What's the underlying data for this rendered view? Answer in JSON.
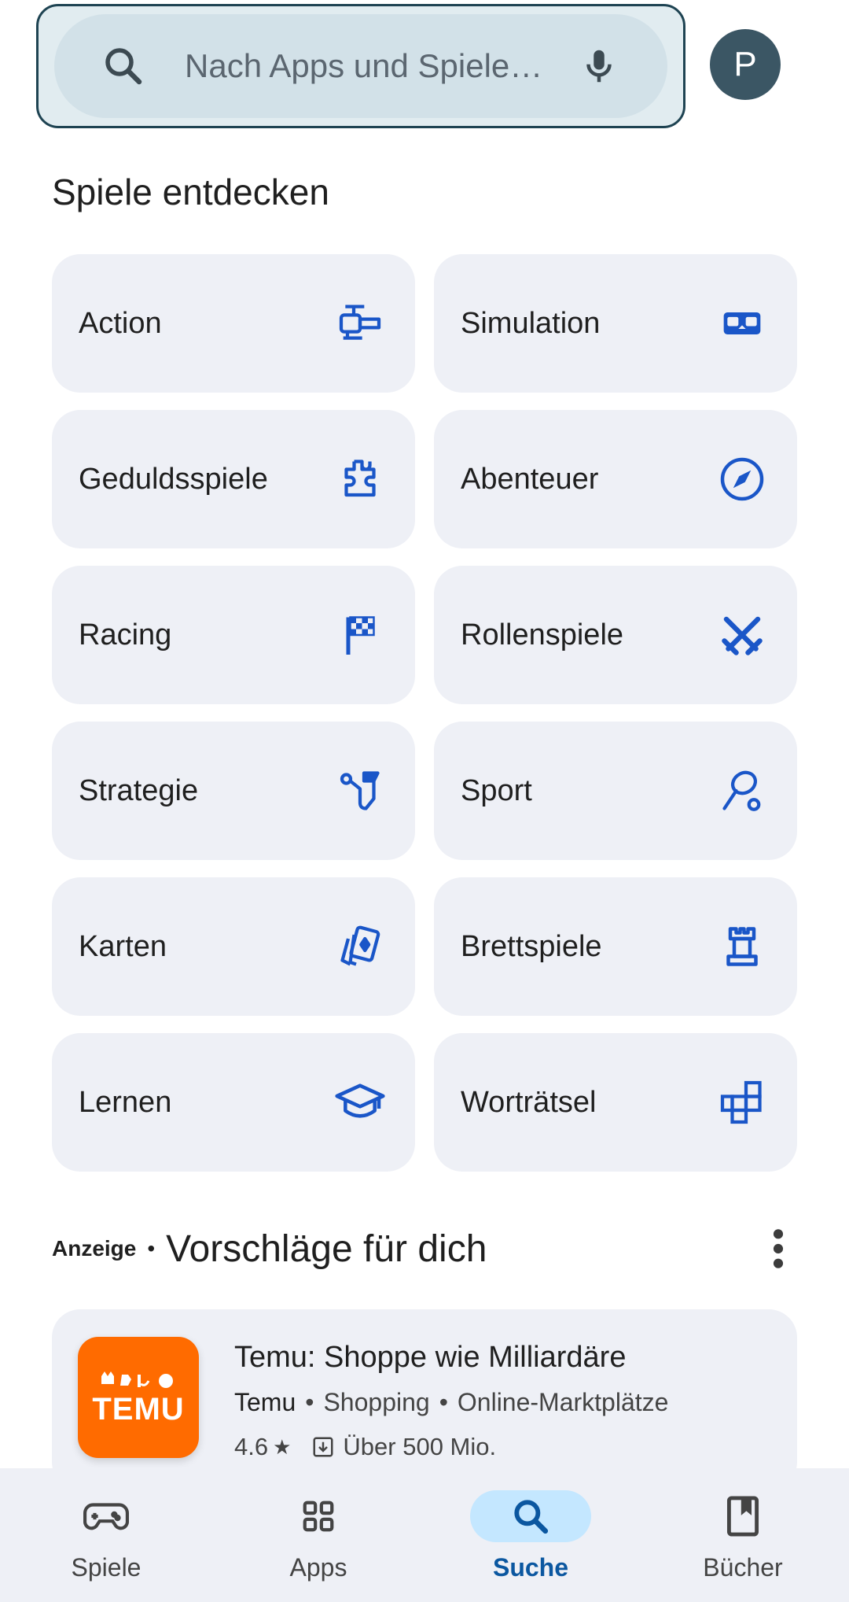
{
  "search": {
    "placeholder": "Nach Apps und Spiele…",
    "avatar_letter": "P"
  },
  "discover": {
    "title": "Spiele entdecken",
    "categories": [
      {
        "label": "Action",
        "icon": "action-icon"
      },
      {
        "label": "Simulation",
        "icon": "simulation-icon"
      },
      {
        "label": "Geduldsspiele",
        "icon": "puzzle-icon"
      },
      {
        "label": "Abenteuer",
        "icon": "compass-icon"
      },
      {
        "label": "Racing",
        "icon": "checkered-flag-icon"
      },
      {
        "label": "Rollenspiele",
        "icon": "crossed-swords-icon"
      },
      {
        "label": "Strategie",
        "icon": "strategy-icon"
      },
      {
        "label": "Sport",
        "icon": "sport-icon"
      },
      {
        "label": "Karten",
        "icon": "cards-icon"
      },
      {
        "label": "Brettspiele",
        "icon": "chess-rook-icon"
      },
      {
        "label": "Lernen",
        "icon": "graduation-cap-icon"
      },
      {
        "label": "Worträtsel",
        "icon": "word-grid-icon"
      }
    ]
  },
  "ads": {
    "tag": "Anzeige",
    "separator": "•",
    "title": "Vorschläge für dich",
    "app": {
      "logo_text": "TEMU",
      "name": "Temu: Shoppe wie Milliardäre",
      "publisher": "Temu",
      "category": "Shopping",
      "subcategory": "Online-Marktplätze",
      "rating": "4.6",
      "rating_star": "★",
      "downloads": "Über 500 Mio."
    }
  },
  "nav": {
    "items": [
      {
        "label": "Spiele",
        "icon": "gamepad-icon",
        "active": false
      },
      {
        "label": "Apps",
        "icon": "apps-grid-icon",
        "active": false
      },
      {
        "label": "Suche",
        "icon": "search-icon",
        "active": true
      },
      {
        "label": "Bücher",
        "icon": "bookmark-book-icon",
        "active": false
      }
    ]
  },
  "colors": {
    "accent": "#1a56c8",
    "card_bg": "#eef0f6",
    "temu_orange": "#ff6b00",
    "nav_active_pill": "#c4e7ff",
    "nav_active_text": "#0b57a0"
  }
}
